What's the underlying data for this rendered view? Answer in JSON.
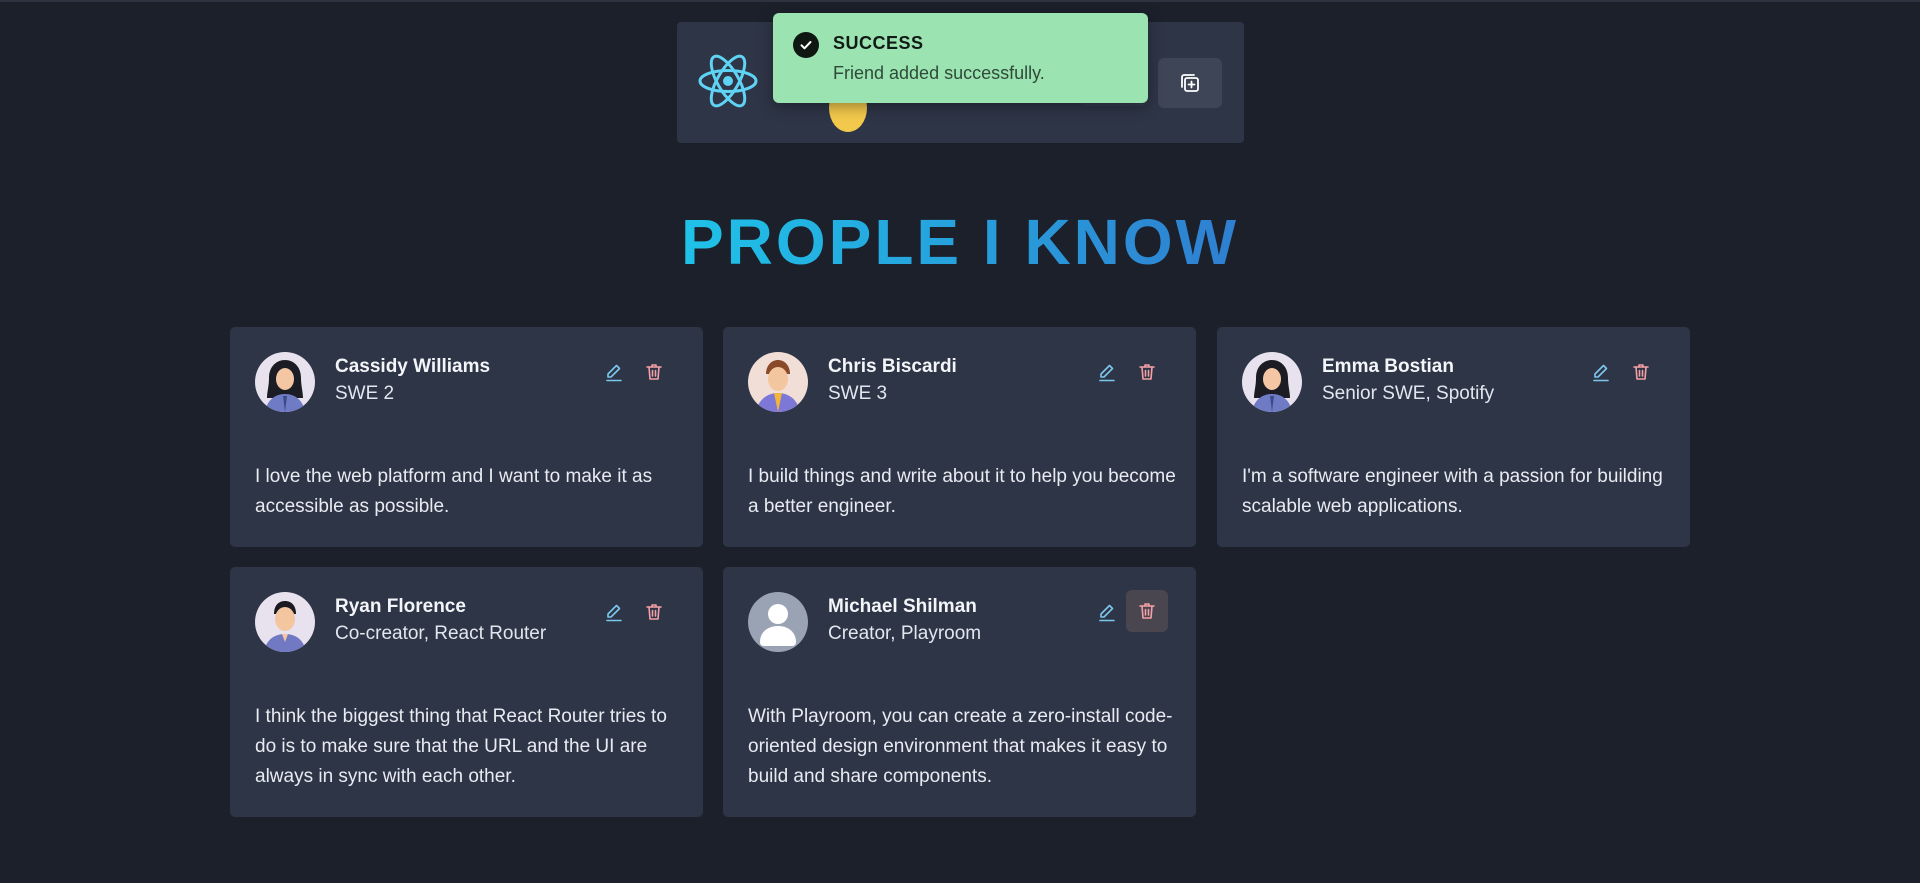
{
  "toast": {
    "title": "SUCCESS",
    "message": "Friend added successfully."
  },
  "page": {
    "title": "PROPLE I KNOW"
  },
  "colors": {
    "background": "#1b202b",
    "card": "#2e3546",
    "toast": "#9be3b0",
    "title_gradient_start": "#1fc2e8",
    "title_gradient_end": "#2f7fd0",
    "edit_icon": "#7cc7ee",
    "delete_icon": "#f2a0a6"
  },
  "header": {
    "logo_icon": "react-logo-icon",
    "add_button_icon": "add-copy-icon"
  },
  "people": [
    {
      "name": "Cassidy Williams",
      "role": "SWE 2",
      "bio": "I love the web platform and I want to make it as accessible as possible."
    },
    {
      "name": "Chris Biscardi",
      "role": "SWE 3",
      "bio": "I build things and write about it to help you become a better engineer."
    },
    {
      "name": "Emma Bostian",
      "role": "Senior SWE, Spotify",
      "bio": "I'm a software engineer with a passion for building scalable web applications."
    },
    {
      "name": "Ryan Florence",
      "role": "Co-creator, React Router",
      "bio": "I think the biggest thing that React Router tries to do is to make sure that the URL and the UI are always in sync with each other."
    },
    {
      "name": "Michael Shilman",
      "role": "Creator, Playroom",
      "bio": "With Playroom, you can create a zero-install code-oriented design environment that makes it easy to build and share components."
    }
  ]
}
